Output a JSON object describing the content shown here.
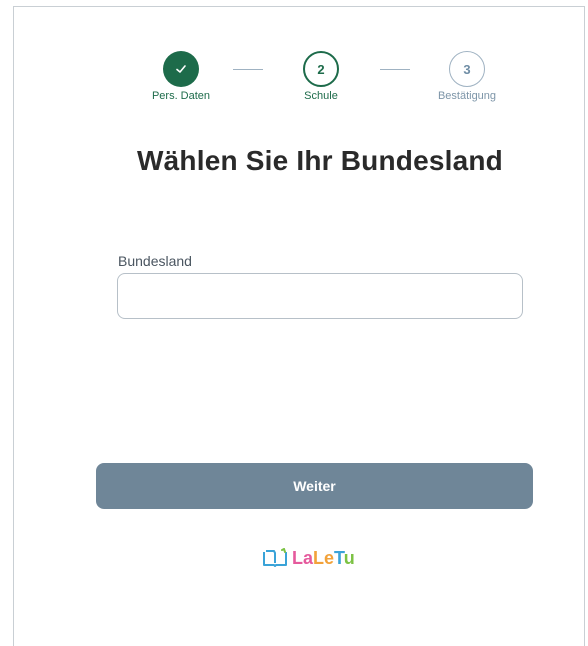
{
  "stepper": {
    "steps": [
      {
        "number": "✓",
        "label": "Pers. Daten",
        "state": "done"
      },
      {
        "number": "2",
        "label": "Schule",
        "state": "active"
      },
      {
        "number": "3",
        "label": "Bestätigung",
        "state": "todo"
      }
    ]
  },
  "page": {
    "title": "Wählen Sie Ihr Bundesland"
  },
  "form": {
    "state_label": "Bundesland",
    "state_value": "",
    "submit_label": "Weiter"
  },
  "logo": {
    "text": "LaLeTu",
    "parts": [
      "La",
      "Le",
      "T",
      "u"
    ],
    "icon": "open-book-icon"
  },
  "colors": {
    "primary_green": "#1d6b4a",
    "button": "#6f8698",
    "muted": "#9fb2c2"
  }
}
